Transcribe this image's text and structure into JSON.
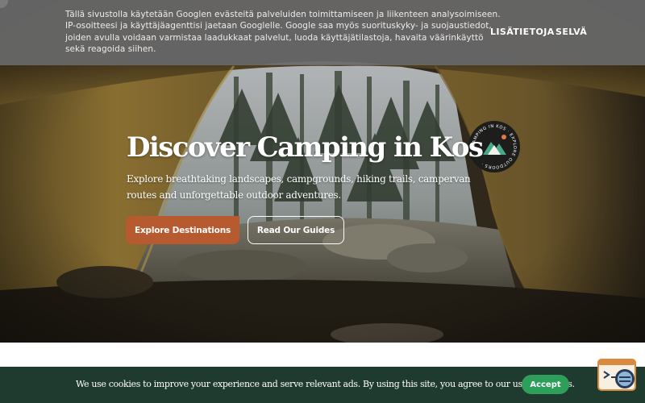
{
  "google_consent": {
    "lines": [
      "Tällä sivustolla käytetään Googlen evästeitä palveluiden toimittamiseen ja liikenteen analysoimiseen.",
      "IP-osoitteesi ja käyttäjäagenttisi jaetaan Googlelle. Google saa myös suorituskyky- ja suojaustiedot,",
      "joiden avulla voidaan varmistaa laadukkaat palvelut, luoda käyttäjätilastoja, havaita väärinkäyttö",
      "sekä reagoida siihen."
    ],
    "more_label": "LISÄTIETOJA",
    "ok_label": "SELVÄ"
  },
  "hero": {
    "title": "Discover Camping in Kos",
    "subtitle_lines": [
      "Explore breathtaking landscapes, campgrounds, hiking trails, campervan",
      "routes and unforgettable outdoor adventures."
    ],
    "primary_button": "Explore Destinations",
    "secondary_button": "Read Our Guides",
    "logo_icon": "camping-in-kos-logo",
    "logo_text": "CAMPING IN KOS · EXPLORE OUTDOORS ·"
  },
  "cookie_bar": {
    "text": "We use cookies to improve your experience and serve relevant ads. By using this site, you agree to our use of cookies.",
    "accept_label": "Accept"
  },
  "colors": {
    "primary_button": "#b85a30",
    "accept_button": "#2e9e5b",
    "cookie_bar_bg": "#1f3b30",
    "banner_bg": "#696969"
  },
  "help_widget": {
    "icon": "chat-help-icon"
  }
}
